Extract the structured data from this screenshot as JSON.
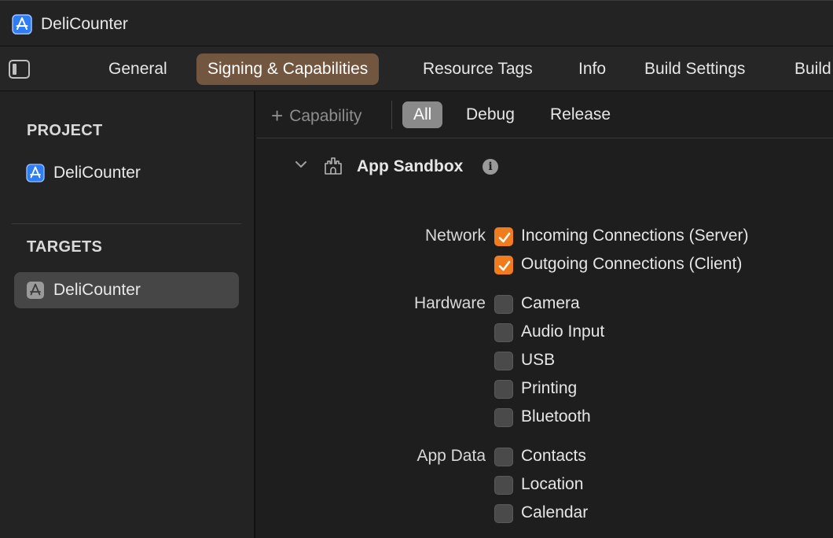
{
  "window": {
    "title": "DeliCounter"
  },
  "tabs": [
    {
      "label": "General"
    },
    {
      "label": "Signing & Capabilities",
      "active": true
    },
    {
      "label": "Resource Tags"
    },
    {
      "label": "Info"
    },
    {
      "label": "Build Settings"
    },
    {
      "label": "Build"
    }
  ],
  "sidebar": {
    "project_section": "PROJECT",
    "project_item": {
      "label": "DeliCounter",
      "icon": "app-store-icon"
    },
    "targets_section": "TARGETS",
    "target_item": {
      "label": "DeliCounter",
      "icon": "app-target-icon",
      "selected": true
    }
  },
  "filterbar": {
    "add_capability": "Capability",
    "filters": [
      {
        "label": "All",
        "active": true
      },
      {
        "label": "Debug"
      },
      {
        "label": "Release"
      }
    ]
  },
  "capability": {
    "title": "App Sandbox",
    "icon": "sandbox-castle-icon",
    "groups": {
      "network": {
        "label": "Network",
        "options": [
          {
            "label": "Incoming Connections (Server)",
            "checked": true
          },
          {
            "label": "Outgoing Connections (Client)",
            "checked": true
          }
        ]
      },
      "hardware": {
        "label": "Hardware",
        "options": [
          {
            "label": "Camera",
            "checked": false
          },
          {
            "label": "Audio Input",
            "checked": false
          },
          {
            "label": "USB",
            "checked": false
          },
          {
            "label": "Printing",
            "checked": false
          },
          {
            "label": "Bluetooth",
            "checked": false
          }
        ]
      },
      "app_data": {
        "label": "App Data",
        "options": [
          {
            "label": "Contacts",
            "checked": false
          },
          {
            "label": "Location",
            "checked": false
          },
          {
            "label": "Calendar",
            "checked": false
          }
        ]
      }
    }
  },
  "colors": {
    "accent": "#f17c1e",
    "active_tab": "#735640"
  }
}
